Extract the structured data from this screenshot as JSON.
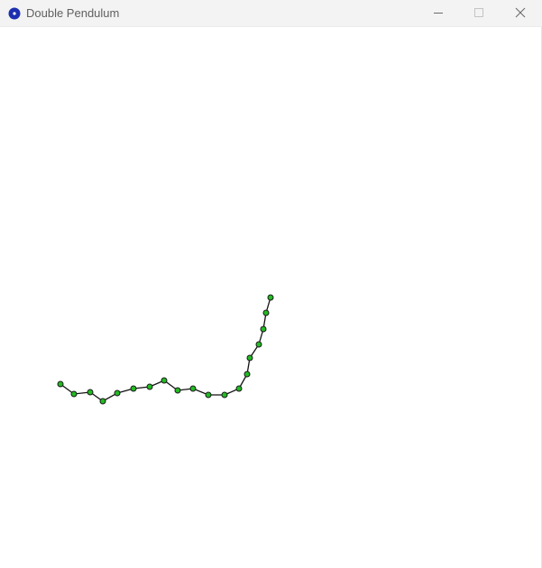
{
  "window": {
    "title": "Double Pendulum",
    "icon": "app-icon",
    "controls": [
      "minimize-icon",
      "maximize-icon",
      "close-icon"
    ]
  },
  "pendulum": {
    "node_fill": "#22bb22",
    "node_stroke": "#1a1a1a",
    "line_color": "#111111"
  }
}
